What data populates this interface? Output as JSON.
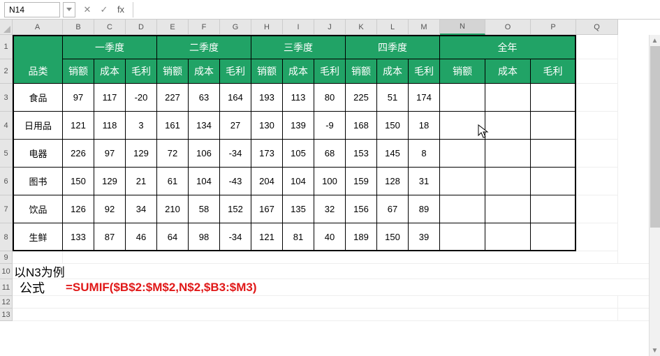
{
  "name_box": "N14",
  "fx_label": "fx",
  "col_headers": [
    "A",
    "B",
    "C",
    "D",
    "E",
    "F",
    "G",
    "H",
    "I",
    "J",
    "K",
    "L",
    "M",
    "N",
    "O",
    "P",
    "Q"
  ],
  "row_headers": [
    "1",
    "2",
    "3",
    "4",
    "5",
    "6",
    "7",
    "8",
    "9",
    "10",
    "11",
    "12",
    "13"
  ],
  "header1": {
    "category": "品类",
    "q1": "一季度",
    "q2": "二季度",
    "q3": "三季度",
    "q4": "四季度",
    "year": "全年"
  },
  "header2": {
    "sales": "销额",
    "cost": "成本",
    "profit": "毛利"
  },
  "rows": [
    {
      "cat": "食品",
      "v": [
        97,
        117,
        -20,
        227,
        63,
        164,
        193,
        113,
        80,
        225,
        51,
        174
      ]
    },
    {
      "cat": "日用品",
      "v": [
        121,
        118,
        3,
        161,
        134,
        27,
        130,
        139,
        -9,
        168,
        150,
        18
      ]
    },
    {
      "cat": "电器",
      "v": [
        226,
        97,
        129,
        72,
        106,
        -34,
        173,
        105,
        68,
        153,
        145,
        8
      ]
    },
    {
      "cat": "图书",
      "v": [
        150,
        129,
        21,
        61,
        104,
        -43,
        204,
        104,
        100,
        159,
        128,
        31
      ]
    },
    {
      "cat": "饮品",
      "v": [
        126,
        92,
        34,
        210,
        58,
        152,
        167,
        135,
        32,
        156,
        67,
        89
      ]
    },
    {
      "cat": "生鲜",
      "v": [
        133,
        87,
        46,
        64,
        98,
        -34,
        121,
        81,
        40,
        189,
        150,
        39
      ]
    }
  ],
  "row10_text": "以N3为例",
  "row11_label": "公式",
  "row11_formula": "=SUMIF($B$2:$M$2,N$2,$B3:$M3)",
  "active_col": "N"
}
